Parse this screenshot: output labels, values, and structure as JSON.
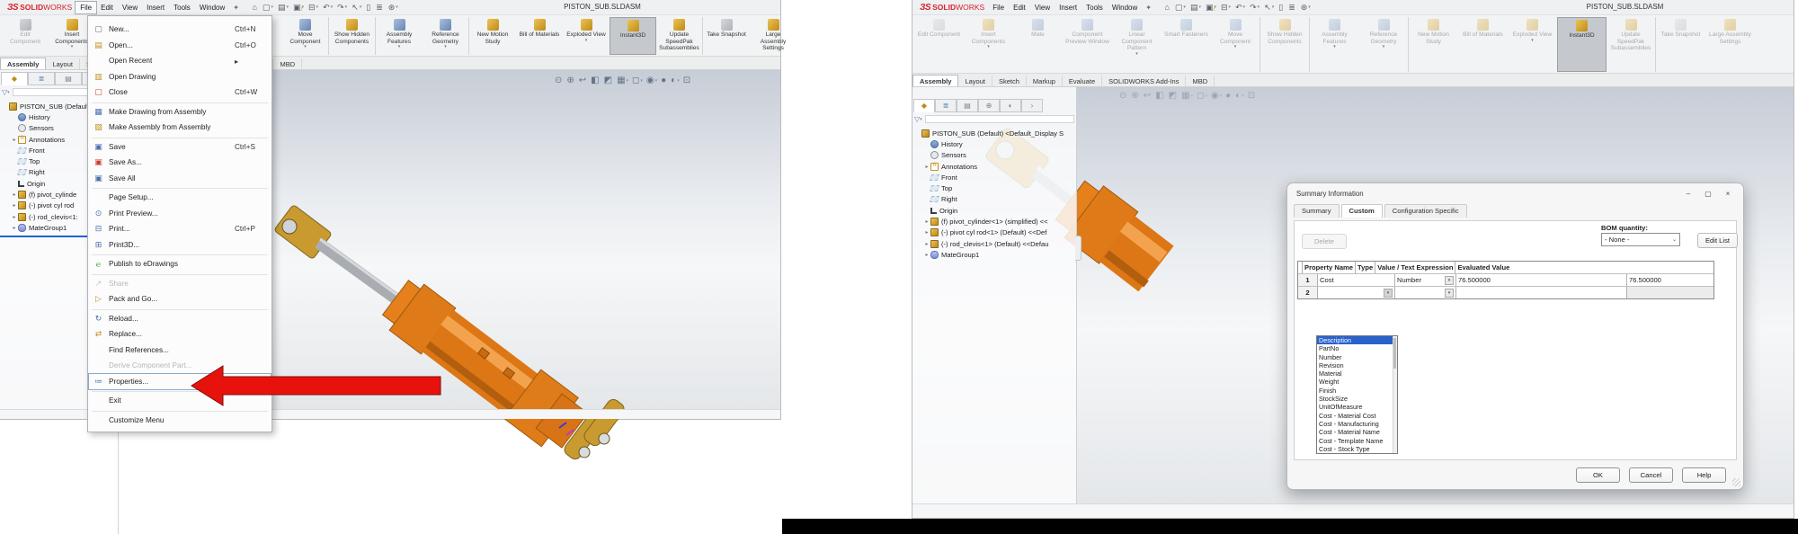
{
  "brand": {
    "mark": "ЗS",
    "solid": "SOLID",
    "works": "WORKS"
  },
  "pin_glyph": "✦",
  "filter_glyph": "▽",
  "left_window": {
    "title": "PISTON_SUB.SLDASM",
    "tree_root": "PISTON_SUB (Default"
  },
  "right_window": {
    "title": "PISTON_SUB.SLDASM",
    "tree_root": "PISTON_SUB (Default) <Default_Display S"
  },
  "menubar": [
    "File",
    "Edit",
    "View",
    "Insert",
    "Tools",
    "Window"
  ],
  "quick_tools": [
    {
      "name": "home-icon",
      "g": "⌂",
      "caret": "",
      "badge": ""
    },
    {
      "name": "new-document-icon",
      "g": "▢",
      "caret": "▾",
      "badge": ""
    },
    {
      "name": "open-icon",
      "g": "▤",
      "caret": "▾",
      "badge": ""
    },
    {
      "name": "save-icon",
      "g": "▣",
      "caret": "▾",
      "badge": "!"
    },
    {
      "name": "print-icon",
      "g": "⊟",
      "caret": "▾",
      "badge": ""
    },
    {
      "name": "undo-icon",
      "g": "↶",
      "caret": "▾",
      "badge": ""
    },
    {
      "name": "redo-icon",
      "g": "↷",
      "caret": "▾",
      "badge": ""
    },
    {
      "name": "select-icon",
      "g": "↖",
      "caret": "▾",
      "badge": ""
    },
    {
      "name": "touch-mode-icon",
      "g": "▯",
      "caret": "",
      "badge": ""
    },
    {
      "name": "display-pane-icon",
      "g": "≣",
      "caret": "",
      "badge": ""
    },
    {
      "name": "options-gear-icon",
      "g": "⊛",
      "caret": "▾",
      "badge": ""
    }
  ],
  "ribbon": [
    {
      "name": "edit-component-button",
      "label": "Edit Component",
      "tone": "gray",
      "caret": "",
      "flag": "dim"
    },
    {
      "name": "insert-components-button",
      "label": "Insert Components",
      "tone": "gold",
      "caret": "▾"
    },
    {
      "name": "mate-button",
      "label": "Mate",
      "tone": "blue",
      "caret": ""
    },
    {
      "name": "component-preview-window-button",
      "label": "Component Preview Window",
      "tone": "blue",
      "caret": ""
    },
    {
      "name": "linear-component-pattern-button",
      "label": "Linear Component Pattern",
      "tone": "blue",
      "caret": "▾"
    },
    {
      "name": "smart-fasteners-button",
      "label": "Smart Fasteners",
      "tone": "blue",
      "caret": ""
    },
    {
      "name": "move-component-button",
      "label": "Move Component",
      "tone": "blue",
      "caret": "▾",
      "sep": "1"
    },
    {
      "name": "show-hidden-components-button",
      "label": "Show Hidden Components",
      "tone": "gold",
      "caret": "",
      "sep": "1"
    },
    {
      "name": "assembly-features-button",
      "label": "Assembly Features",
      "tone": "blue",
      "caret": "▾"
    },
    {
      "name": "reference-geometry-button",
      "label": "Reference Geometry",
      "tone": "blue",
      "caret": "▾",
      "sep": "1"
    },
    {
      "name": "new-motion-study-button",
      "label": "New Motion Study",
      "tone": "gold",
      "caret": ""
    },
    {
      "name": "bill-of-materials-button",
      "label": "Bill of Materials",
      "tone": "gold",
      "caret": ""
    },
    {
      "name": "exploded-view-button",
      "label": "Exploded View",
      "tone": "gold",
      "caret": "▾"
    },
    {
      "name": "instant3d-button",
      "label": "Instant3D",
      "tone": "gold",
      "caret": "",
      "flag": "active"
    },
    {
      "name": "update-speedpak-button",
      "label": "Update SpeedPak Subassemblies",
      "tone": "gold",
      "caret": "",
      "sep": "1"
    },
    {
      "name": "take-snapshot-button",
      "label": "Take Snapshot",
      "tone": "gray",
      "caret": ""
    },
    {
      "name": "large-assembly-settings-button",
      "label": "Large Assembly Settings",
      "tone": "gold",
      "caret": ""
    }
  ],
  "window_tabs": [
    {
      "label": "Assembly",
      "flag": "on"
    },
    {
      "label": "Layout"
    },
    {
      "label": "Sketch"
    },
    {
      "label": "Markup"
    },
    {
      "label": "Evaluate"
    },
    {
      "label": "SOLIDWORKS Add-Ins"
    },
    {
      "label": "MBD"
    }
  ],
  "panel_tabs": [
    {
      "name": "featuremanager-tab-icon",
      "g": "◆",
      "tone": "gold",
      "flag": "on"
    },
    {
      "name": "propertymanager-tab-icon",
      "g": "≣",
      "tone": "blue"
    },
    {
      "name": "configurationmanager-tab-icon",
      "g": "▤",
      "tone": ""
    },
    {
      "name": "dimxpertmanager-tab-icon",
      "g": "⊕",
      "tone": ""
    },
    {
      "name": "displaymanager-tab-icon",
      "g": "◐",
      "tone": ""
    },
    {
      "name": "panel-tabs-overflow-icon",
      "g": "›",
      "tone": ""
    }
  ],
  "headsup": [
    {
      "name": "zoom-fit-icon",
      "g": "⊙",
      "caret": ""
    },
    {
      "name": "zoom-area-icon",
      "g": "⊕",
      "caret": ""
    },
    {
      "name": "previous-view-icon",
      "g": "↩",
      "caret": ""
    },
    {
      "name": "section-view-icon",
      "g": "◧",
      "caret": ""
    },
    {
      "name": "appearance-tools-icon",
      "g": "◩",
      "caret": ""
    },
    {
      "name": "view-orientation-icon",
      "g": "▦",
      "caret": "▾"
    },
    {
      "name": "display-style-icon",
      "g": "◻",
      "caret": "▾"
    },
    {
      "name": "hide-show-items-icon",
      "g": "◉",
      "caret": "▾"
    },
    {
      "name": "edit-appearance-icon",
      "g": "●",
      "caret": ""
    },
    {
      "name": "apply-scene-icon",
      "g": "◐",
      "caret": "▾"
    },
    {
      "name": "view-settings-icon",
      "g": "⊡",
      "caret": ""
    }
  ],
  "file_menu": {
    "items": [
      {
        "g": "▢",
        "tone": "gray",
        "label": "New...",
        "sc": "Ctrl+N"
      },
      {
        "g": "▤",
        "tone": "gold",
        "label": "Open...",
        "sc": "Ctrl+O"
      },
      {
        "g": "",
        "tone": "",
        "label": "Open Recent",
        "sc": "▸"
      },
      {
        "g": "▥",
        "tone": "gold",
        "label": "Open Drawing",
        "sc": ""
      },
      {
        "g": "▢",
        "tone": "red",
        "label": "Close",
        "sc": "Ctrl+W"
      },
      {
        "state": "sep"
      },
      {
        "g": "▦",
        "tone": "blue",
        "label": "Make Drawing from Assembly",
        "sc": ""
      },
      {
        "g": "▧",
        "tone": "gold",
        "label": "Make Assembly from Assembly",
        "sc": ""
      },
      {
        "state": "sep"
      },
      {
        "g": "▣",
        "tone": "blue",
        "label": "Save",
        "sc": "Ctrl+S"
      },
      {
        "g": "▣",
        "tone": "red",
        "label": "Save As...",
        "sc": ""
      },
      {
        "g": "▣",
        "tone": "blue",
        "label": "Save All",
        "sc": ""
      },
      {
        "state": "sep"
      },
      {
        "g": "",
        "tone": "",
        "label": "Page Setup...",
        "sc": ""
      },
      {
        "g": "⊙",
        "tone": "blue",
        "label": "Print Preview...",
        "sc": ""
      },
      {
        "g": "⊟",
        "tone": "blue",
        "label": "Print...",
        "sc": "Ctrl+P"
      },
      {
        "g": "⊞",
        "tone": "blue",
        "label": "Print3D...",
        "sc": ""
      },
      {
        "state": "sep"
      },
      {
        "g": "℮",
        "tone": "green",
        "label": "Publish to eDrawings",
        "sc": ""
      },
      {
        "state": "sep"
      },
      {
        "g": "↗",
        "tone": "gray",
        "label": "Share",
        "sc": "",
        "state": "disabled"
      },
      {
        "g": "▷",
        "tone": "gold",
        "label": "Pack and Go...",
        "sc": ""
      },
      {
        "state": "sep"
      },
      {
        "g": "↻",
        "tone": "blue",
        "label": "Reload...",
        "sc": ""
      },
      {
        "g": "⇄",
        "tone": "gold",
        "label": "Replace...",
        "sc": ""
      },
      {
        "g": "",
        "tone": "",
        "label": "Find References...",
        "sc": ""
      },
      {
        "g": "",
        "tone": "",
        "label": "Derive Component Part...",
        "sc": "",
        "state": "disabled"
      },
      {
        "g": "≔",
        "tone": "blue",
        "label": "Properties...",
        "sc": "",
        "state": "focus"
      },
      {
        "state": "sep"
      },
      {
        "g": "",
        "tone": "",
        "label": "Exit",
        "sc": ""
      },
      {
        "state": "sep"
      },
      {
        "g": "",
        "tone": "",
        "label": "Customize Menu",
        "sc": ""
      }
    ]
  },
  "left_tree": [
    {
      "i": "history",
      "label": "History",
      "ex": ""
    },
    {
      "i": "sensors",
      "label": "Sensors",
      "ex": ""
    },
    {
      "i": "annotations",
      "label": "Annotations",
      "ex": "▸"
    },
    {
      "i": "plane",
      "label": "Front",
      "ex": ""
    },
    {
      "i": "plane",
      "label": "Top",
      "ex": ""
    },
    {
      "i": "plane",
      "label": "Right",
      "ex": ""
    },
    {
      "i": "origin",
      "label": "Origin",
      "ex": ""
    },
    {
      "i": "part",
      "label": "(f) pivot_cylinde",
      "ex": "▸"
    },
    {
      "i": "part",
      "label": "(-) pivot cyl rod",
      "ex": "▸"
    },
    {
      "i": "part",
      "label": "(-) rod_clevis<1:",
      "ex": "▸"
    },
    {
      "i": "mates",
      "label": "MateGroup1",
      "ex": "▸"
    }
  ],
  "right_tree": [
    {
      "i": "history",
      "label": "History",
      "ex": ""
    },
    {
      "i": "sensors",
      "label": "Sensors",
      "ex": ""
    },
    {
      "i": "annotations",
      "label": "Annotations",
      "ex": "▸"
    },
    {
      "i": "plane",
      "label": "Front",
      "ex": ""
    },
    {
      "i": "plane",
      "label": "Top",
      "ex": ""
    },
    {
      "i": "plane",
      "label": "Right",
      "ex": ""
    },
    {
      "i": "origin",
      "label": "Origin",
      "ex": ""
    },
    {
      "i": "part",
      "label": "(f) pivot_cylinder<1> (simplified) <<",
      "ex": "▸"
    },
    {
      "i": "part",
      "label": "(-) pivot cyl rod<1> (Default) <<Def",
      "ex": "▸"
    },
    {
      "i": "part",
      "label": "(-) rod_clevis<1> (Default) <<Defau",
      "ex": "▸"
    },
    {
      "i": "mates",
      "label": "MateGroup1",
      "ex": "▸"
    }
  ],
  "dialog": {
    "title": "Summary Information",
    "controls": {
      "minimize": "–",
      "maximize": "▢",
      "close": "×"
    },
    "tabs": [
      {
        "label": "Summary"
      },
      {
        "label": "Custom",
        "flag": "on"
      },
      {
        "label": "Configuration Specific"
      }
    ],
    "delete_label": "Delete",
    "bom_label": "BOM quantity:",
    "bom_value": "- None -",
    "edit_list_label": "Edit List",
    "table": {
      "headers": [
        "",
        "Property Name",
        "Type",
        "Value / Text Expression",
        "Evaluated Value"
      ],
      "rows": [
        {
          "num": "1",
          "name": "Cost",
          "type": "Number",
          "value": "76.500000",
          "evaluated": "76.500000"
        },
        {
          "num": "2",
          "name": "",
          "type": "",
          "value": "",
          "evaluated": ""
        }
      ]
    },
    "property_list": [
      "Description",
      "PartNo",
      "Number",
      "Revision",
      "Material",
      "Weight",
      "Finish",
      "StockSize",
      "UnitOfMeasure",
      "Cost - Material Cost",
      "Cost - Manufacturing",
      "Cost - Material Name",
      "Cost - Template Name",
      "Cost - Stock Type"
    ],
    "buttons": [
      {
        "name": "ok-button",
        "label": "OK"
      },
      {
        "name": "cancel-button",
        "label": "Cancel"
      },
      {
        "name": "help-button",
        "label": "Help"
      }
    ]
  },
  "colors": {
    "orange": "#dd7614",
    "gold": "#c89a30",
    "steel": "#a9adb2",
    "arrow_red": "#e8120c",
    "selection_blue": "#2a62cc",
    "logo_red": "#d8222a"
  }
}
